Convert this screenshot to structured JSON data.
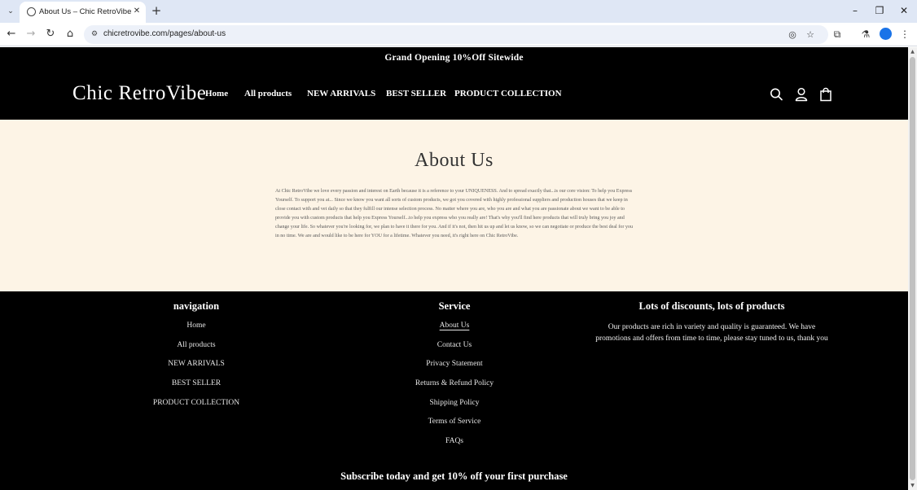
{
  "browser": {
    "tab_title": "About Us – Chic RetroVibe",
    "url": "chicretrovibe.com/pages/about-us"
  },
  "site": {
    "announcement": "Grand Opening 10%Off Sitewide",
    "logo": "Chic RetroVibe",
    "nav": [
      "Home",
      "All products",
      "NEW ARRIVALS",
      "BEST SELLER",
      "PRODUCT COLLECTION"
    ]
  },
  "about": {
    "title": "About Us",
    "body": "At Chic RetroVibe we love every passion and interest on Earth because it is a reference to your UNIQUENESS. And to spread exactly that...is our core vision: To help you Express Yourself. To support you at... Since we know you want all sorts of custom products, we got you covered with highly professional suppliers and production houses that we keep in close contact with and vet daily so that they fulfill our intense selection process. No matter where you are, who you are and what you are passionate about we want to be able to provide you with custom products that help you Express Yourself...to help you express who you really are! That's why you'll find here products that will truly bring you joy and change your life. So whatever you're looking for, we plan to have it there for you. And if it's not, then hit us up and let us know, so we can negotiate or produce the best deal for you in no time. We are and would like to be here for YOU for a lifetime. Whatever you need, it's right here on Chic RetroVibe."
  },
  "footer": {
    "navigation": {
      "heading": "navigation",
      "links": [
        "Home",
        "All products",
        "NEW ARRIVALS",
        "BEST SELLER",
        "PRODUCT COLLECTION"
      ]
    },
    "service": {
      "heading": "Service",
      "links": [
        "About Us",
        "Contact Us",
        "Privacy Statement",
        "Returns & Refund Policy",
        "Shipping Policy",
        "Terms of Service",
        "FAQs"
      ]
    },
    "promo": {
      "heading": "Lots of discounts, lots of products",
      "text": "Our products are rich in variety and quality is guaranteed. We have promotions and offers from time to time, please stay tuned to us, thank you"
    },
    "subscribe": "Subscribe today and get 10% off your first purchase"
  }
}
